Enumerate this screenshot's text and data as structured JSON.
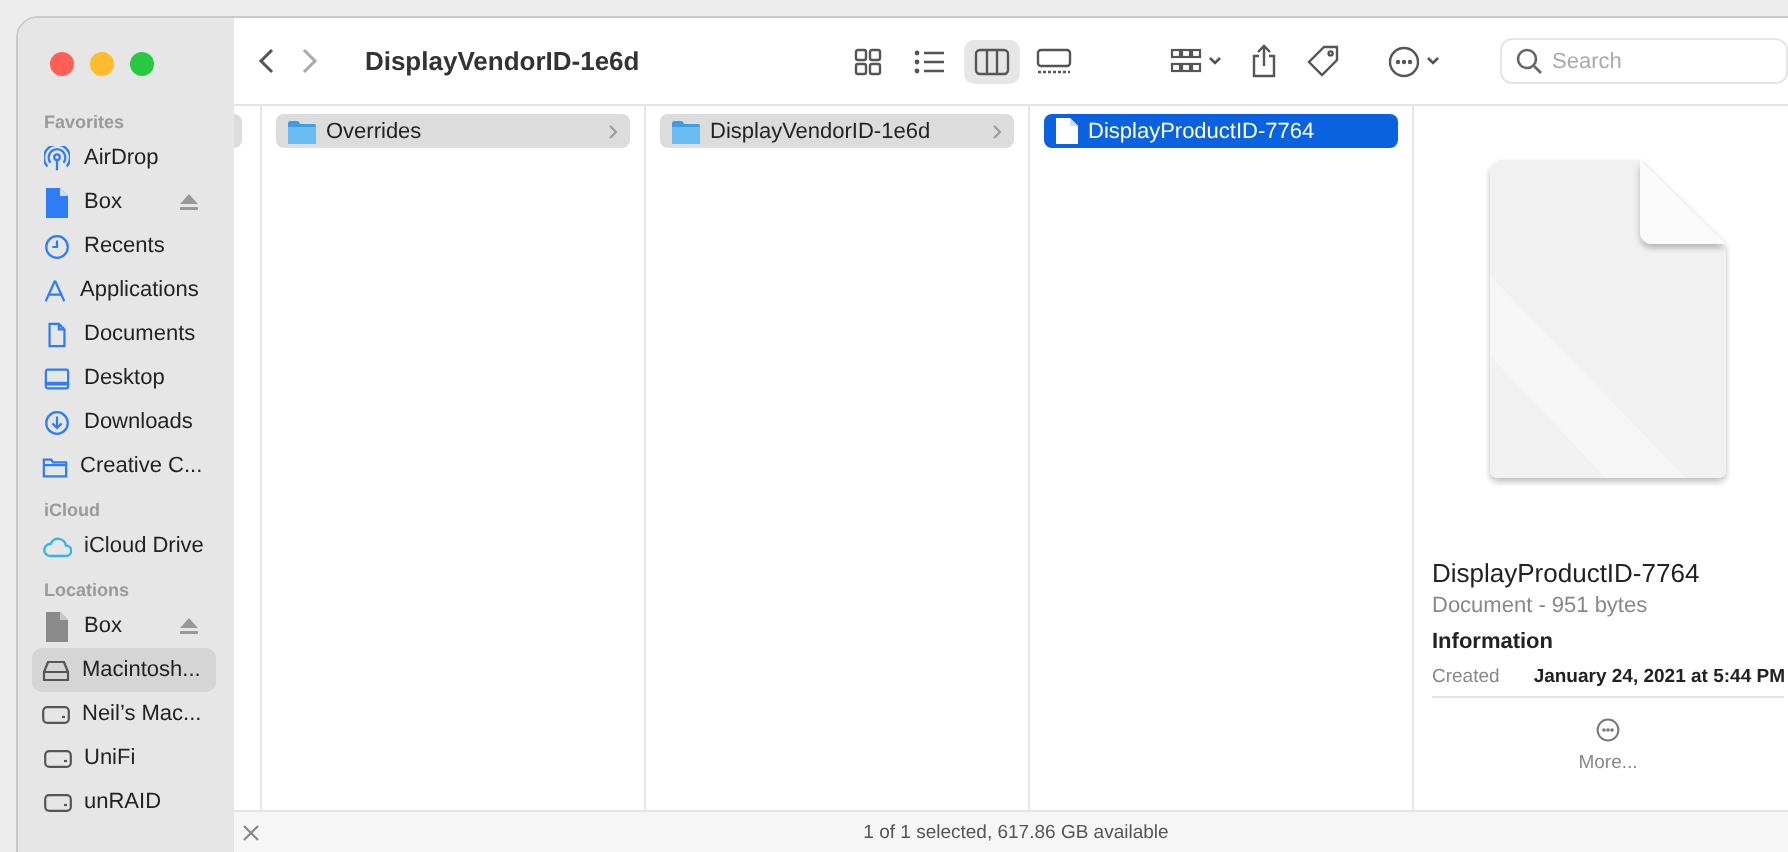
{
  "window": {
    "title": "DisplayVendorID-1e6d"
  },
  "toolbar": {
    "views": [
      {
        "kind": "icons",
        "selected": false
      },
      {
        "kind": "list",
        "selected": false
      },
      {
        "kind": "columns",
        "selected": true
      },
      {
        "kind": "gallery",
        "selected": false
      }
    ],
    "search": {
      "placeholder": "Search"
    }
  },
  "sidebar": {
    "sections": [
      {
        "title": "Favorites",
        "items": [
          {
            "label": "AirDrop",
            "kind": "airdrop",
            "selected": false,
            "ejectable": false
          },
          {
            "label": "Box",
            "kind": "file",
            "selected": false,
            "ejectable": true
          },
          {
            "label": "Recents",
            "kind": "clock",
            "selected": false,
            "ejectable": false
          },
          {
            "label": "Applications",
            "kind": "apps",
            "selected": false,
            "ejectable": false
          },
          {
            "label": "Documents",
            "kind": "document",
            "selected": false,
            "ejectable": false
          },
          {
            "label": "Desktop",
            "kind": "desktop",
            "selected": false,
            "ejectable": false
          },
          {
            "label": "Downloads",
            "kind": "download",
            "selected": false,
            "ejectable": false
          },
          {
            "label": "Creative C...",
            "kind": "folder",
            "selected": false,
            "ejectable": false
          }
        ]
      },
      {
        "title": "iCloud",
        "items": [
          {
            "label": "iCloud Drive",
            "kind": "cloud",
            "selected": false,
            "ejectable": false
          }
        ]
      },
      {
        "title": "Locations",
        "items": [
          {
            "label": "Box",
            "kind": "greyfile",
            "selected": false,
            "ejectable": true
          },
          {
            "label": "Macintosh...",
            "kind": "disk",
            "selected": true,
            "ejectable": false
          },
          {
            "label": "Neil’s Mac...",
            "kind": "drive",
            "selected": false,
            "ejectable": false
          },
          {
            "label": "UniFi",
            "kind": "drive",
            "selected": false,
            "ejectable": false
          },
          {
            "label": "unRAID",
            "kind": "drive",
            "selected": false,
            "ejectable": false
          }
        ]
      }
    ]
  },
  "columns": [
    {
      "focused": false,
      "items": [
        {
          "label": "Overrides",
          "kind": "folder",
          "selected": true,
          "has_children": true
        }
      ]
    },
    {
      "focused": false,
      "items": [
        {
          "label": "DisplayVendorID-1e6d",
          "kind": "folder",
          "selected": true,
          "has_children": true
        }
      ]
    },
    {
      "focused": true,
      "items": [
        {
          "label": "DisplayProductID-7764",
          "kind": "document",
          "selected": true,
          "has_children": false
        }
      ]
    }
  ],
  "preview": {
    "name": "DisplayProductID-7764",
    "subtitle": "Document - 951 bytes",
    "section": "Information",
    "fields": [
      {
        "label": "Created",
        "value": "January 24, 2021 at 5:44 PM"
      }
    ],
    "more": "More..."
  },
  "status_bar": {
    "text": "1 of 1 selected, 617.86 GB available"
  }
}
